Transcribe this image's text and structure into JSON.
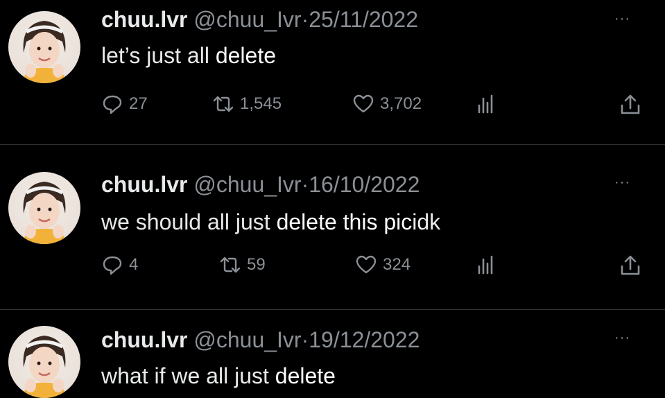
{
  "tweets": [
    {
      "name": "chuu.lvr",
      "handle": "@chuu_Ivr",
      "separator": "·",
      "date": "25/11/2022",
      "text_a": "let’s just all",
      "text_b": "delete",
      "text_c": "",
      "replies": "27",
      "retweets": "1,545",
      "likes": "3,702"
    },
    {
      "name": "chuu.lvr",
      "handle": "@chuu_Ivr",
      "separator": "·",
      "date": "16/10/2022",
      "text_a": "we should all just",
      "text_b": "delete this pic",
      "text_c": "idk",
      "replies": "4",
      "retweets": "59",
      "likes": "324"
    },
    {
      "name": "chuu.lvr",
      "handle": "@chuu_Ivr",
      "separator": "·",
      "date": "19/12/2022",
      "text_a": "what if we all just",
      "text_b": "delete",
      "text_c": ""
    }
  ],
  "icons": {
    "reply": "reply-icon",
    "retweet": "retweet-icon",
    "like": "heart-icon",
    "views": "analytics-icon",
    "share": "share-icon",
    "more": "more-icon"
  },
  "more_label": "···",
  "colors": {
    "background": "#000000",
    "primary_text": "#e7e9ea",
    "secondary_text": "#8b9096",
    "divider": "#2f3336"
  }
}
